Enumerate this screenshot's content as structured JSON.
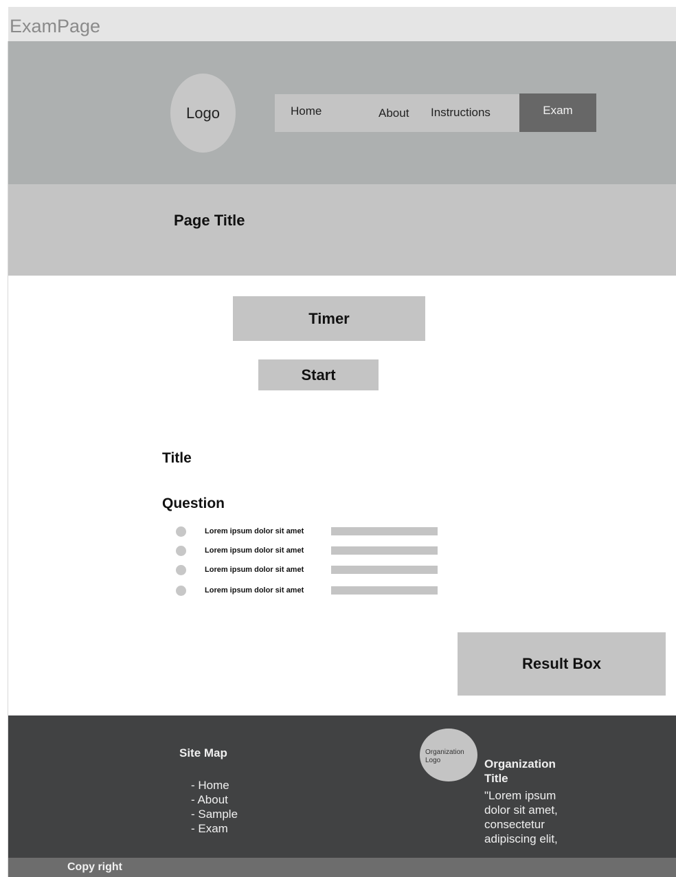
{
  "frame": {
    "label": "ExamPage"
  },
  "header": {
    "logo_text": "Logo",
    "nav": [
      {
        "label": "Home"
      },
      {
        "label": "About"
      },
      {
        "label": "Instructions"
      },
      {
        "label": "Exam",
        "active": true
      }
    ]
  },
  "title_band": {
    "page_title": "Page Title"
  },
  "exam": {
    "timer_label": "Timer",
    "start_label": "Start",
    "section_title": "Title",
    "question_label": "Question",
    "options": [
      {
        "text": "Lorem ipsum dolor sit amet"
      },
      {
        "text": "Lorem ipsum dolor sit amet"
      },
      {
        "text": "Lorem ipsum dolor sit amet"
      },
      {
        "text": "Lorem ipsum dolor sit amet"
      }
    ],
    "result_box_label": "Result Box"
  },
  "footer": {
    "sitemap_title": "Site Map",
    "sitemap_links": [
      "- Home",
      "- About",
      "- Sample",
      "- Exam"
    ],
    "org_logo_text": "Organization Logo",
    "org_title": "Organization Title",
    "org_description": "\"Lorem ipsum dolor sit amet, consectetur adipiscing elit,",
    "copyright": "Copy right"
  },
  "colors": {
    "header_bg": "#adb0b0",
    "band_bg": "#c4c4c4",
    "active_nav_bg": "#676767",
    "footer_bg": "#414243",
    "copyright_bg": "#6d6d6d"
  }
}
